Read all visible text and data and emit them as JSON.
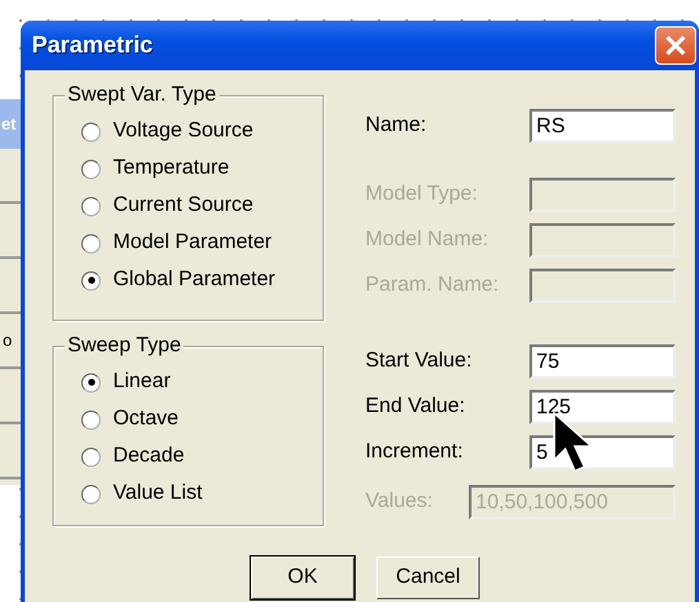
{
  "background_window": {
    "title": "et",
    "label": "o"
  },
  "window": {
    "title": "Parametric"
  },
  "swept_var_type": {
    "title": "Swept Var. Type",
    "options": [
      {
        "label": "Voltage Source",
        "selected": false
      },
      {
        "label": "Temperature",
        "selected": false
      },
      {
        "label": "Current Source",
        "selected": false
      },
      {
        "label": "Model Parameter",
        "selected": false
      },
      {
        "label": "Global Parameter",
        "selected": true
      }
    ]
  },
  "sweep_type": {
    "title": "Sweep Type",
    "options": [
      {
        "label": "Linear",
        "selected": true
      },
      {
        "label": "Octave",
        "selected": false
      },
      {
        "label": "Decade",
        "selected": false
      },
      {
        "label": "Value List",
        "selected": false
      }
    ]
  },
  "fields": [
    {
      "label": "Name:",
      "value": "RS",
      "disabled": false
    },
    {
      "label": "Model Type:",
      "disabled": true
    },
    {
      "label": "Model Name:",
      "disabled": true
    },
    {
      "label": "Param. Name:",
      "disabled": true
    },
    {
      "label": "Start Value:",
      "value": "75",
      "disabled": false
    },
    {
      "label": "End Value:",
      "value": "125",
      "disabled": false
    },
    {
      "label": "Increment:",
      "value": "5",
      "disabled": false
    }
  ],
  "values_field": {
    "label": "Values:",
    "value": "10,50,100,500",
    "disabled": true
  },
  "buttons": [
    {
      "label": "OK",
      "default": true
    },
    {
      "label": "Cancel",
      "default": false
    }
  ]
}
